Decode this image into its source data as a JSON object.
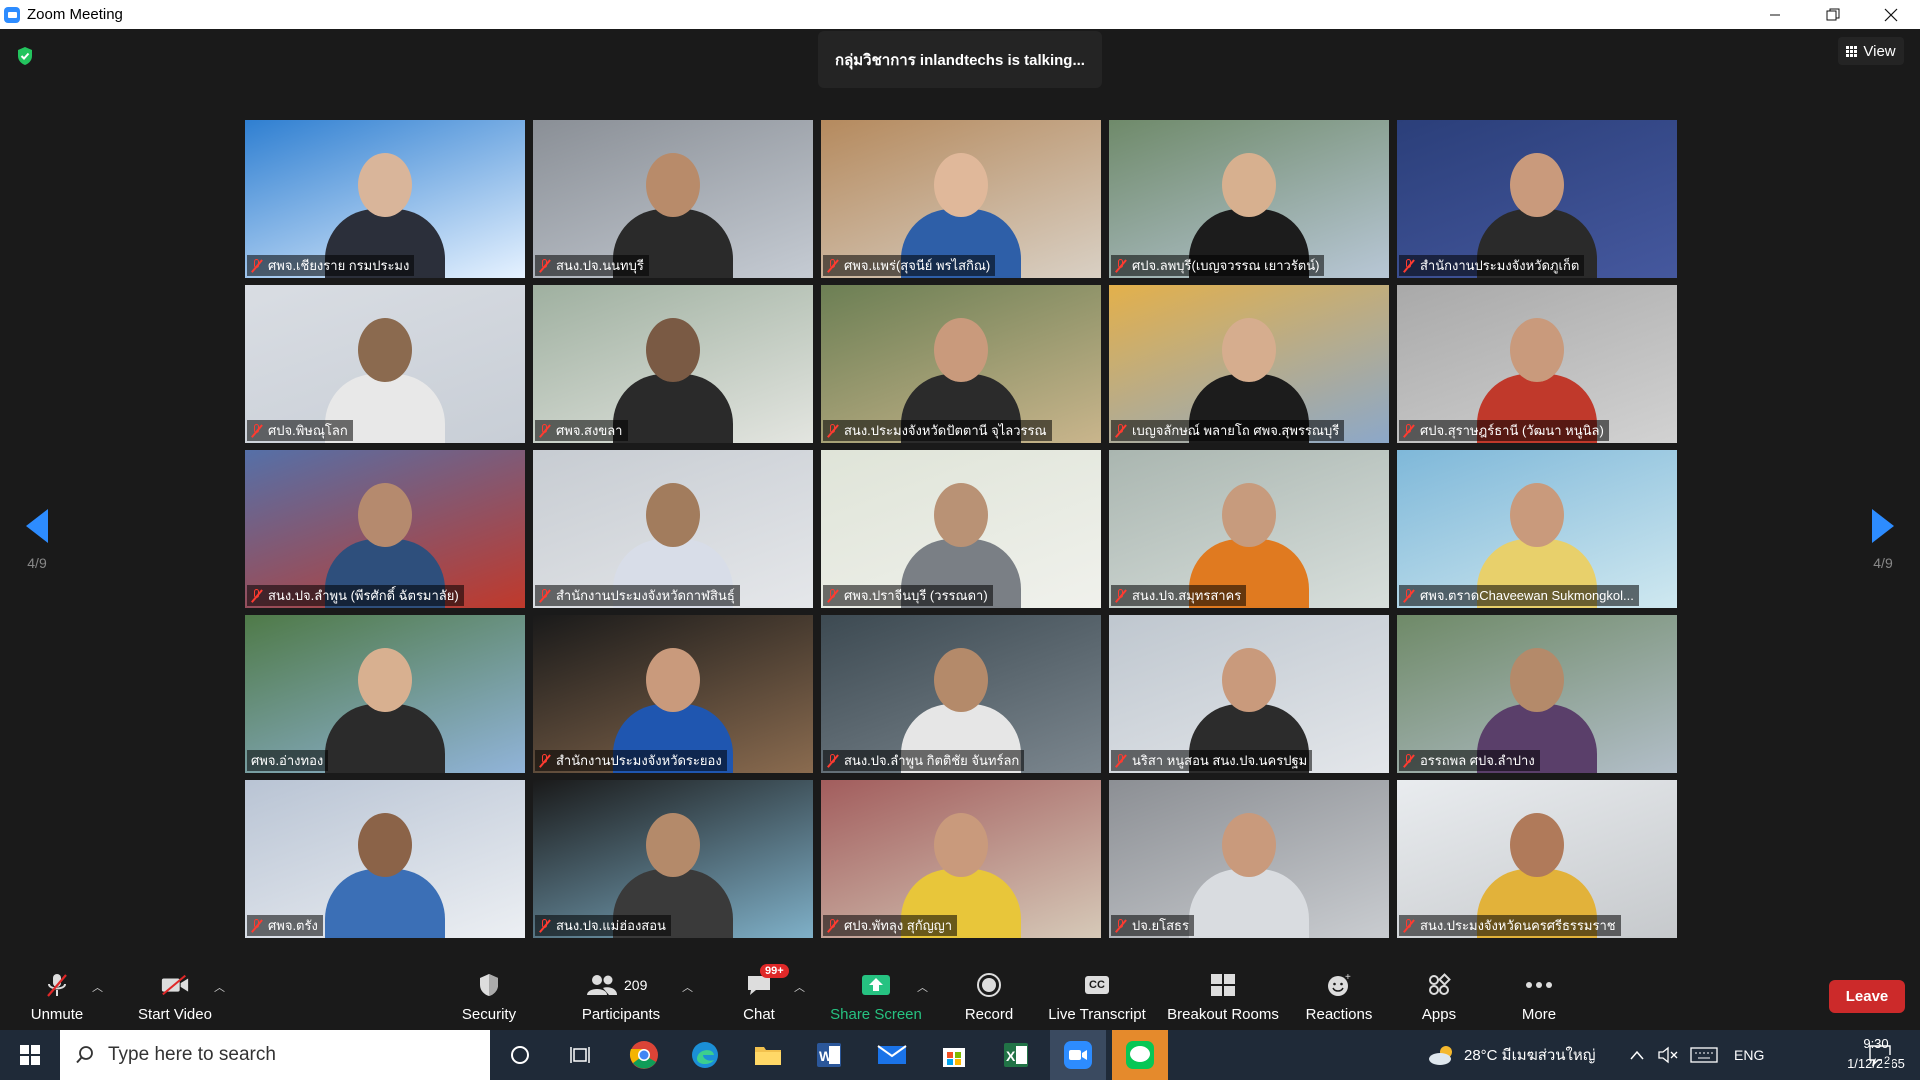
{
  "window": {
    "title": "Zoom Meeting",
    "controls": [
      "minimize-icon",
      "restore-icon",
      "close-icon"
    ]
  },
  "meeting": {
    "talking_banner": "กลุ่มวิชาการ inlandtechs  is  talking...",
    "view_label": "View",
    "page_indicator_left": "4/9",
    "page_indicator_right": "4/9",
    "participants": [
      {
        "name": "ศพจ.เชียงราย กรมประมง",
        "muted": true
      },
      {
        "name": "สนง.ปจ.นนทบุรี",
        "muted": true
      },
      {
        "name": "ศพจ.แพร่(สุจนีย์ พรไสกิณ)",
        "muted": true
      },
      {
        "name": "ศปจ.ลพบุรี(เบญจวรรณ เยาวรัตน์)",
        "muted": true
      },
      {
        "name": "สำนักงานประมงจังหวัดภูเก็ต",
        "muted": true
      },
      {
        "name": "ศปจ.พิษณุโลก",
        "muted": true
      },
      {
        "name": "ศพจ.สงขลา",
        "muted": true
      },
      {
        "name": "สนง.ประมงจังหวัดปัตตานี จุไลวรรณ",
        "muted": true
      },
      {
        "name": "เบญจลักษณ์  พลายโถ ศพจ.สุพรรณบุรี",
        "muted": true
      },
      {
        "name": "ศปจ.สุราษฎร์ธานี (วัฒนา หนูนิล)",
        "muted": true
      },
      {
        "name": "สนง.ปจ.ลำพูน (พีรศักดิ์ ฉัตรมาลัย)",
        "muted": true
      },
      {
        "name": "สำนักงานประมงจังหวัดกาฬสินธุ์",
        "muted": true
      },
      {
        "name": "ศพจ.ปราจีนบุรี (วรรณดา)",
        "muted": true
      },
      {
        "name": "สนง.ปจ.สมุทรสาคร",
        "muted": true
      },
      {
        "name": "ศพจ.ตราดChaveewan Sukmongkol...",
        "muted": true
      },
      {
        "name": "ศพจ.อ่างทอง",
        "muted": false
      },
      {
        "name": "สำนักงานประมงจังหวัดระยอง",
        "muted": true
      },
      {
        "name": "สนง.ปจ.ลำพูน กิตติชัย  จันทร์ลก",
        "muted": true
      },
      {
        "name": "นริสา  หนูสอน สนง.ปจ.นครปฐม",
        "muted": true
      },
      {
        "name": "อรรถพล ศปจ.ลำปาง",
        "muted": true
      },
      {
        "name": "ศพจ.ตรัง",
        "muted": true
      },
      {
        "name": "สนง.ปจ.แม่ฮ่องสอน",
        "muted": true
      },
      {
        "name": "ศปจ.พัทลุง สุกัญญา",
        "muted": true
      },
      {
        "name": "ปจ.ยโสธร",
        "muted": true
      },
      {
        "name": "สนง.ประมงจังหวัดนครศรีธรรมราช",
        "muted": true
      }
    ]
  },
  "toolbar": {
    "unmute": "Unmute",
    "start_video": "Start Video",
    "security": "Security",
    "participants": "Participants",
    "participants_count": "209",
    "chat": "Chat",
    "chat_badge": "99+",
    "share_screen": "Share Screen",
    "record": "Record",
    "live_transcript": "Live Transcript",
    "live_transcript_icon_text": "CC",
    "breakout_rooms": "Breakout Rooms",
    "reactions": "Reactions",
    "apps": "Apps",
    "more": "More",
    "leave": "Leave"
  },
  "taskbar": {
    "search_placeholder": "Type here to search",
    "weather": "28°C  มีเมฆส่วนใหญ่",
    "language": "ENG",
    "time": "9:30",
    "date": "1/12/2565",
    "notification_count": "2",
    "apps": [
      "task-view-icon",
      "chrome-icon",
      "edge-icon",
      "file-explorer-icon",
      "word-icon",
      "mail-icon",
      "store-icon",
      "excel-icon",
      "zoom-icon",
      "line-icon"
    ]
  },
  "colors": {
    "accent": "#2d8cff",
    "leave": "#cc2a2a",
    "share": "#26c281",
    "mute": "#ff3b30"
  }
}
